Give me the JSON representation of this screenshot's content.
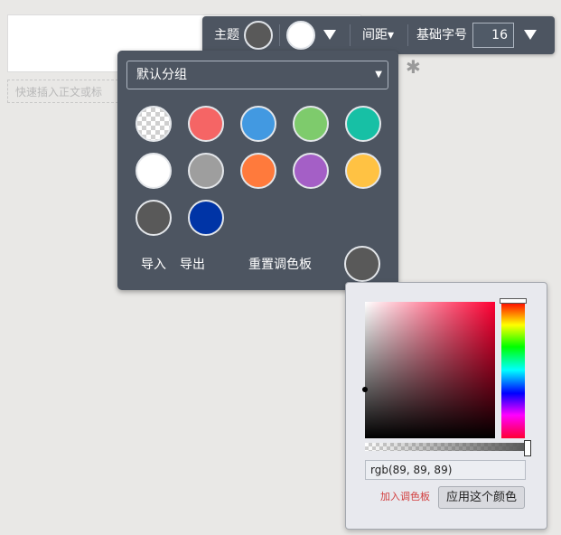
{
  "editor": {
    "quick_insert_placeholder": "快速插入正文或标"
  },
  "toolbar": {
    "theme_label": "主题",
    "theme_color": "#595959",
    "text_color": "#ffffff",
    "spacing_label": "间距▾",
    "base_font_label": "基础字号",
    "base_font_value": "16"
  },
  "palette": {
    "group_name": "默认分组",
    "swatches": [
      {
        "name": "transparent",
        "color": "transparent"
      },
      {
        "name": "red",
        "color": "#f56565"
      },
      {
        "name": "blue",
        "color": "#4299e1"
      },
      {
        "name": "green",
        "color": "#7ecb6c"
      },
      {
        "name": "teal",
        "color": "#17c0a5"
      },
      {
        "name": "white",
        "color": "#ffffff"
      },
      {
        "name": "gray",
        "color": "#9e9e9e"
      },
      {
        "name": "orange",
        "color": "#ff7a3c"
      },
      {
        "name": "purple",
        "color": "#a45fc6"
      },
      {
        "name": "yellow",
        "color": "#ffc243"
      },
      {
        "name": "dark-gray",
        "color": "#595959"
      },
      {
        "name": "navy",
        "color": "#0034a6"
      }
    ],
    "import_label": "导入",
    "export_label": "导出",
    "reset_label": "重置调色板",
    "current_color": "#595959"
  },
  "picker": {
    "value": "rgb(89, 89, 89)",
    "add_to_palette_label": "加入调色板",
    "apply_label": "应用这个颜色"
  }
}
